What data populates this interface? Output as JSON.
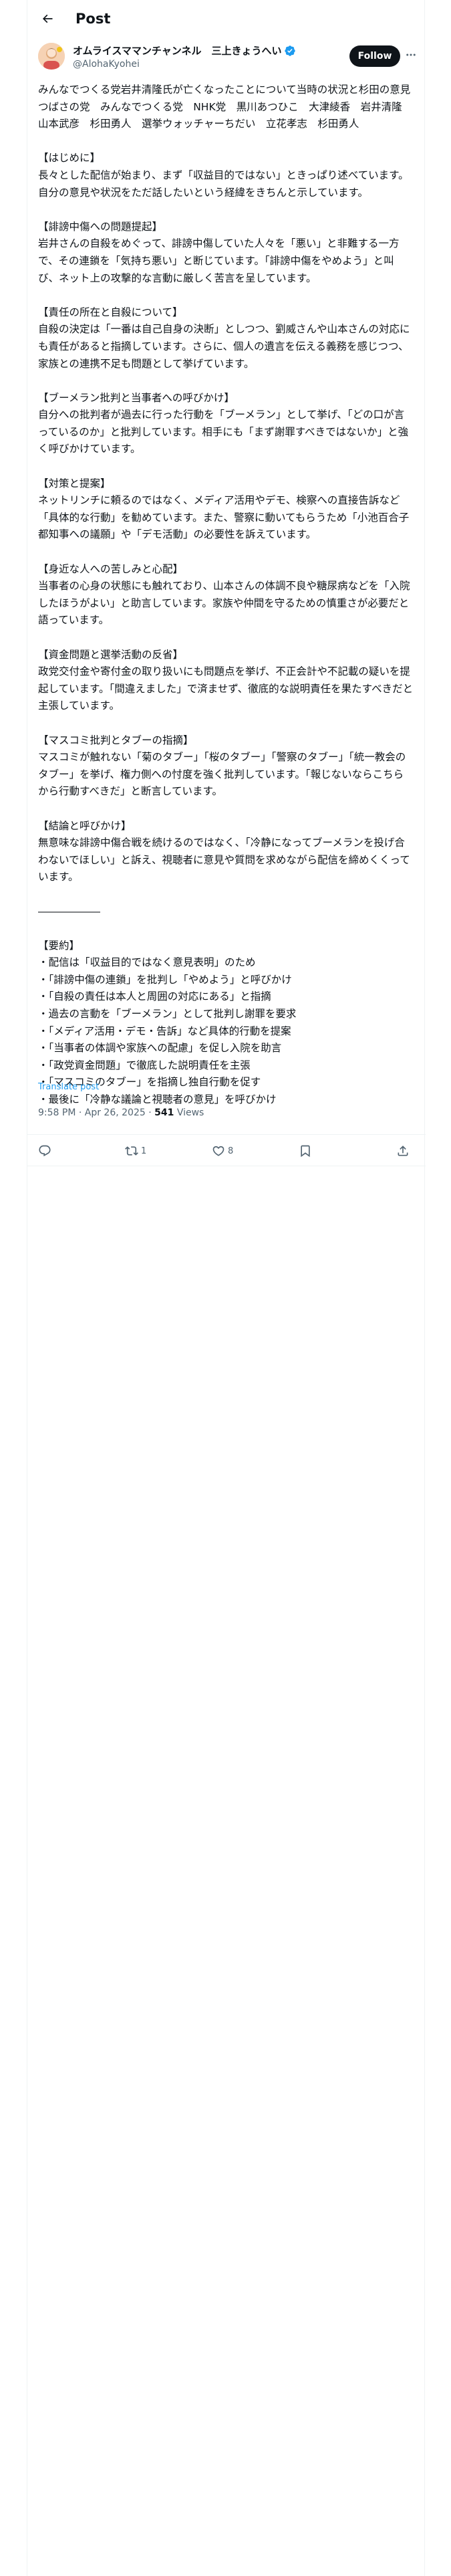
{
  "header": {
    "title": "Post",
    "back_icon": "arrow-left-icon"
  },
  "author": {
    "name": "オムライスママンチャンネル　三上きょうへい",
    "handle": "@AlohaKyohei",
    "verified": true,
    "verified_color": "#1d9bf0",
    "follow_label": "Follow",
    "more_icon": "more-horizontal-icon"
  },
  "post": {
    "body": "みんなでつくる党岩井清隆氏が亡くなったことについて当時の状況と杉田の意見　つばさの党　みんなでつくる党　NHK党　黒川あつひこ　大津綾香　岩井清隆　山本武彦　杉田勇人　選挙ウォッチャーちだい　立花孝志　杉田勇人\n\n【はじめに】\n長々とした配信が始まり、まず「収益目的ではない」ときっぱり述べています。自分の意見や状況をただ話したいという経緯をきちんと示しています。\n\n【誹謗中傷への問題提起】\n岩井さんの自殺をめぐって、誹謗中傷していた人々を「悪い」と非難する一方で、その連鎖を「気持ち悪い」と断じています。「誹謗中傷をやめよう」と叫び、ネット上の攻撃的な言動に厳しく苦言を呈しています。\n\n【責任の所在と自殺について】\n自殺の決定は「一番は自己自身の決断」としつつ、劉威さんや山本さんの対応にも責任があると指摘しています。さらに、個人の遺言を伝える義務を感じつつ、家族との連携不足も問題として挙げています。\n\n【ブーメラン批判と当事者への呼びかけ】\n自分への批判者が過去に行った行動を「ブーメラン」として挙げ、「どの口が言っているのか」と批判しています。相手にも「まず謝罪すべきではないか」と強く呼びかけています。\n\n【対策と提案】\nネットリンチに頼るのではなく、メディア活用やデモ、検察への直接告訴など「具体的な行動」を勧めています。また、警察に動いてもらうため「小池百合子都知事への議願」や「デモ活動」の必要性を訴えています。\n\n【身近な人への苦しみと心配】\n当事者の心身の状態にも触れており、山本さんの体調不良や糖尿病などを「入院したほうがよい」と助言しています。家族や仲間を守るための慎重さが必要だと語っています。\n\n【資金問題と選挙活動の反省】\n政党交付金や寄付金の取り扱いにも問題点を挙げ、不正会計や不記載の疑いを提起しています。「間違えました」で済ませず、徹底的な説明責任を果たすべきだと主張しています。\n\n【マスコミ批判とタブーの指摘】\nマスコミが触れない「菊のタブー」「桜のタブー」「警察のタブー」「統一教会のタブー」を挙げ、権力側への忖度を強く批判しています。「報じないならこちらから行動すべきだ」と断言しています。\n\n【結論と呼びかけ】\n無意味な誹謗中傷合戦を続けるのではなく、「冷静になってブーメランを投げ合わないでほしい」と訴え、視聴者に意見や質問を求めながら配信を締めくくっています。\n\n――――――\n\n【要約】\n・配信は「収益目的ではなく意見表明」のため\n・「誹謗中傷の連鎖」を批判し「やめよう」と呼びかけ\n・「自殺の責任は本人と周囲の対応にある」と指摘\n・過去の言動を「ブーメラン」として批判し謝罪を要求\n・「メディア活用・デモ・告訴」など具体的行動を提案\n・「当事者の体調や家族への配慮」を促し入院を助言\n・「政党資金問題」で徹底した説明責任を主張\n・「マスコミのタブー」を指摘し独自行動を促す\n・最後に「冷静な議論と視聴者の意見」を呼びかけ",
    "translate_label": "Translate post",
    "time": "9:58 PM · Apr 26, 2025",
    "separator": " · ",
    "views_count": "541",
    "views_label": "Views"
  },
  "actions": {
    "reply_icon": "reply-icon",
    "repost_icon": "repost-icon",
    "repost_count": "1",
    "like_icon": "heart-icon",
    "like_count": "8",
    "bookmark_icon": "bookmark-icon",
    "share_icon": "share-icon"
  }
}
